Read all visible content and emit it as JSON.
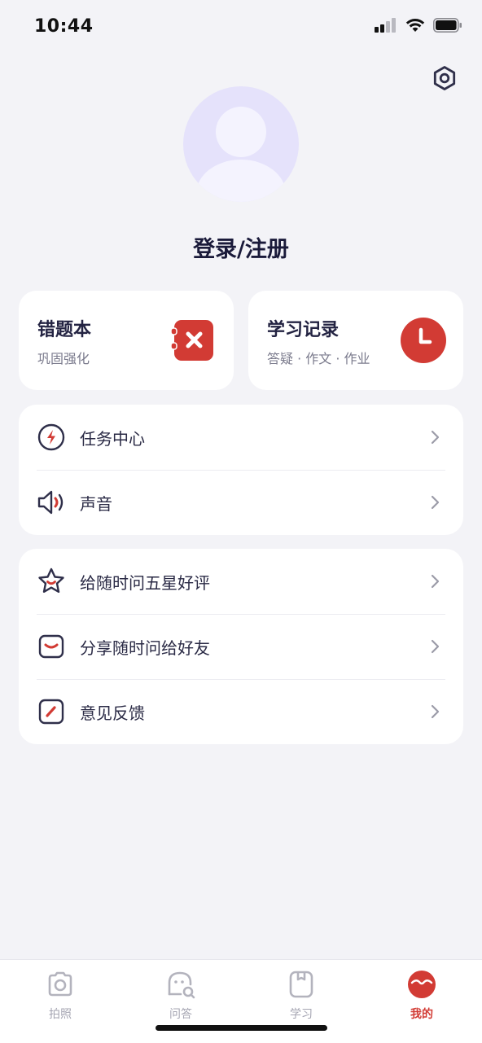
{
  "status_bar": {
    "time": "10:44"
  },
  "profile": {
    "login_label": "登录/注册"
  },
  "cards": {
    "wrong_book": {
      "title": "错题本",
      "subtitle": "巩固强化",
      "icon": "wrong-book-icon"
    },
    "study_record": {
      "title": "学习记录",
      "subtitle": "答疑 · 作文 · 作业",
      "icon": "clock-icon"
    }
  },
  "menu_group_1": [
    {
      "label": "任务中心",
      "icon": "lightning-icon"
    },
    {
      "label": "声音",
      "icon": "speaker-icon"
    }
  ],
  "menu_group_2": [
    {
      "label": "给随时问五星好评",
      "icon": "star-icon"
    },
    {
      "label": "分享随时问给好友",
      "icon": "share-icon"
    },
    {
      "label": "意见反馈",
      "icon": "feedback-icon"
    }
  ],
  "tab_bar": {
    "tabs": [
      {
        "label": "拍照",
        "icon": "camera-icon",
        "active": false
      },
      {
        "label": "问答",
        "icon": "chat-icon",
        "active": false
      },
      {
        "label": "学习",
        "icon": "book-icon",
        "active": false
      },
      {
        "label": "我的",
        "icon": "profile-icon",
        "active": true
      }
    ]
  },
  "colors": {
    "accent": "#d23b34",
    "background": "#f3f3f7",
    "card": "#ffffff",
    "avatar_bg": "#e5e2fb"
  }
}
